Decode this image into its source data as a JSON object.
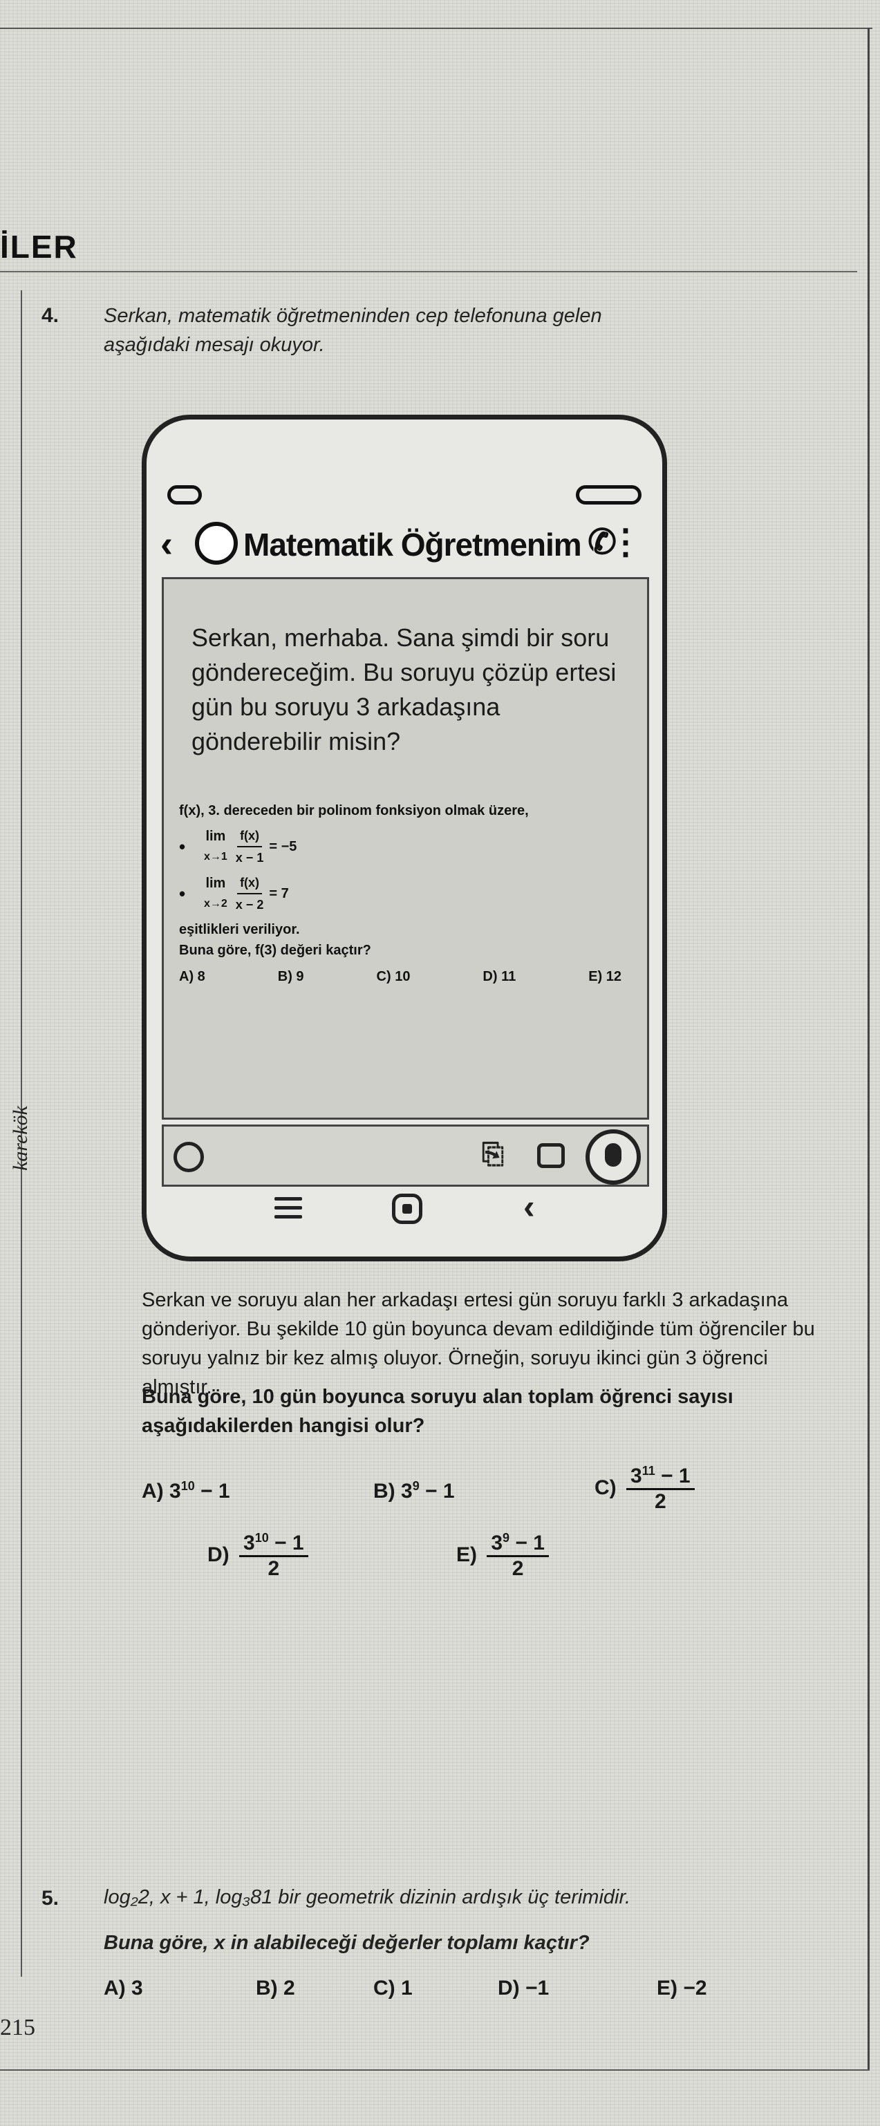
{
  "header": {
    "section_title": "İLER",
    "side_label": "karekök"
  },
  "q4": {
    "number": "4.",
    "intro_line1": "Serkan, matematik öğretmeninden cep telefonuna gelen",
    "intro_line2": "aşağıdaki mesajı okuyor.",
    "phone": {
      "contact_name": "Matematik Öğretmenim",
      "message": "Serkan, merhaba. Sana şimdi bir soru göndereceğim. Bu soruyu çözüp ertesi gün bu soruyu 3 arkadaşına gönderebilir misin?",
      "question_line": "f(x), 3. dereceden bir polinom fonksiyon olmak üzere,",
      "limit1_sub": "x→1",
      "limit1_num": "f(x)",
      "limit1_den": "x − 1",
      "limit1_result": "= −5",
      "limit2_sub": "x→2",
      "limit2_num": "f(x)",
      "limit2_den": "x − 2",
      "limit2_result": "= 7",
      "given_text": "eşitlikleri veriliyor.",
      "ask_text": "Buna göre, f(3) değeri kaçtır?",
      "options": [
        "A) 8",
        "B) 9",
        "C) 10",
        "D) 11",
        "E) 12"
      ]
    },
    "body_p1": "Serkan ve soruyu alan her arkadaşı ertesi gün soruyu farklı 3 arkadaşına gönderiyor. Bu şekilde 10 gün boyunca devam edildiğinde tüm öğrenciler bu soruyu yalnız bir kez almış oluyor. Örneğin, soruyu ikinci gün 3 öğrenci almıştır.",
    "body_p2": "Buna göre, 10 gün boyunca soruyu alan toplam öğrenci sayısı aşağıdakilerden hangisi olur?",
    "opt_a_prefix": "A) 3",
    "opt_a_exp": "10",
    "opt_a_tail": " − 1",
    "opt_b_prefix": "B) 3",
    "opt_b_exp": "9",
    "opt_b_tail": " − 1",
    "opt_c_label": "C)",
    "opt_c_base": "3",
    "opt_c_exp": "11",
    "opt_c_tail": " − 1",
    "opt_c_den": "2",
    "opt_d_label": "D)",
    "opt_d_base": "3",
    "opt_d_exp": "10",
    "opt_d_tail": " − 1",
    "opt_d_den": "2",
    "opt_e_label": "E)",
    "opt_e_base": "3",
    "opt_e_exp": "9",
    "opt_e_tail": " − 1",
    "opt_e_den": "2"
  },
  "q5": {
    "number": "5.",
    "line1": "log₂2, x + 1, log₃81 bir geometrik dizinin ardışık üç terimidir.",
    "line2": "Buna göre, x in alabileceği değerler toplamı kaçtır?",
    "options": [
      "A) 3",
      "B) 2",
      "C) 1",
      "D) −1",
      "E) −2"
    ]
  },
  "footer": {
    "page_number": "215"
  }
}
